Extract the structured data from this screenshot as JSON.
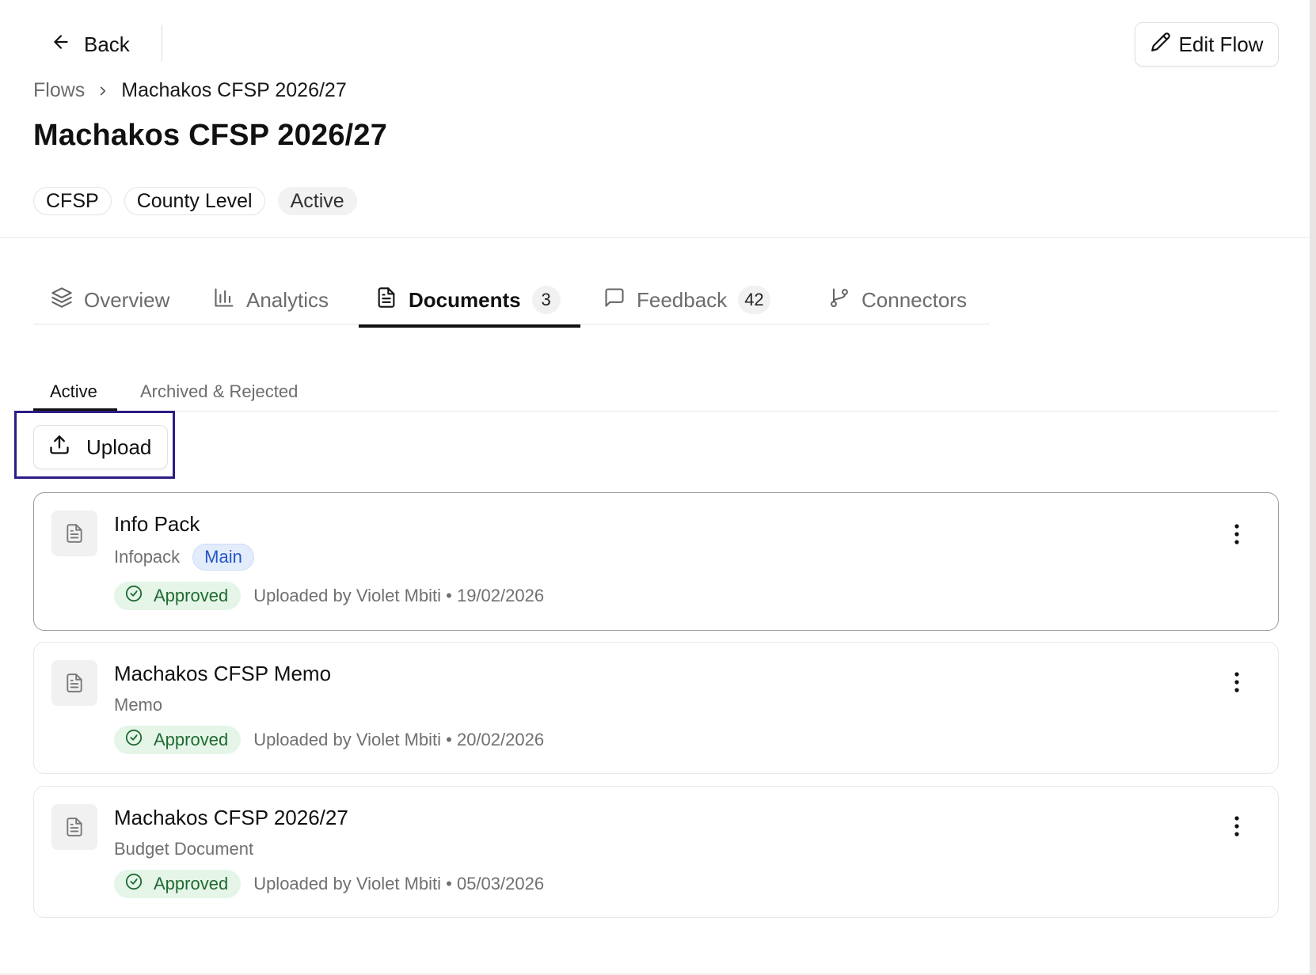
{
  "header": {
    "back_label": "Back",
    "edit_label": "Edit Flow"
  },
  "breadcrumb": {
    "root": "Flows",
    "current": "Machakos CFSP 2026/27"
  },
  "page_title": "Machakos CFSP 2026/27",
  "chips": [
    "CFSP",
    "County Level",
    "Active"
  ],
  "tabs": [
    {
      "label": "Overview",
      "icon": "layers-icon"
    },
    {
      "label": "Analytics",
      "icon": "bar-chart-icon"
    },
    {
      "label": "Documents",
      "icon": "document-icon",
      "count": "3",
      "active": true
    },
    {
      "label": "Feedback",
      "icon": "message-icon",
      "count": "42"
    },
    {
      "label": "Connectors",
      "icon": "git-branch-icon"
    }
  ],
  "subtabs": [
    {
      "label": "Active",
      "active": true
    },
    {
      "label": "Archived & Rejected"
    }
  ],
  "upload_label": "Upload",
  "documents": [
    {
      "title": "Info Pack",
      "type": "Infopack",
      "badge": "Main",
      "status": "Approved",
      "meta": "Uploaded by Violet Mbiti • 19/02/2026"
    },
    {
      "title": "Machakos CFSP Memo",
      "type": "Memo",
      "status": "Approved",
      "meta": "Uploaded by Violet Mbiti • 20/02/2026"
    },
    {
      "title": "Machakos CFSP 2026/27",
      "type": "Budget Document",
      "status": "Approved",
      "meta": "Uploaded by Violet Mbiti • 05/03/2026"
    }
  ],
  "colors": {
    "highlight": "#2b1d86",
    "approved_bg": "#e5f5e7",
    "approved_text": "#1f6b33",
    "main_badge_bg": "#e3ecfb",
    "main_badge_text": "#2456c8"
  }
}
